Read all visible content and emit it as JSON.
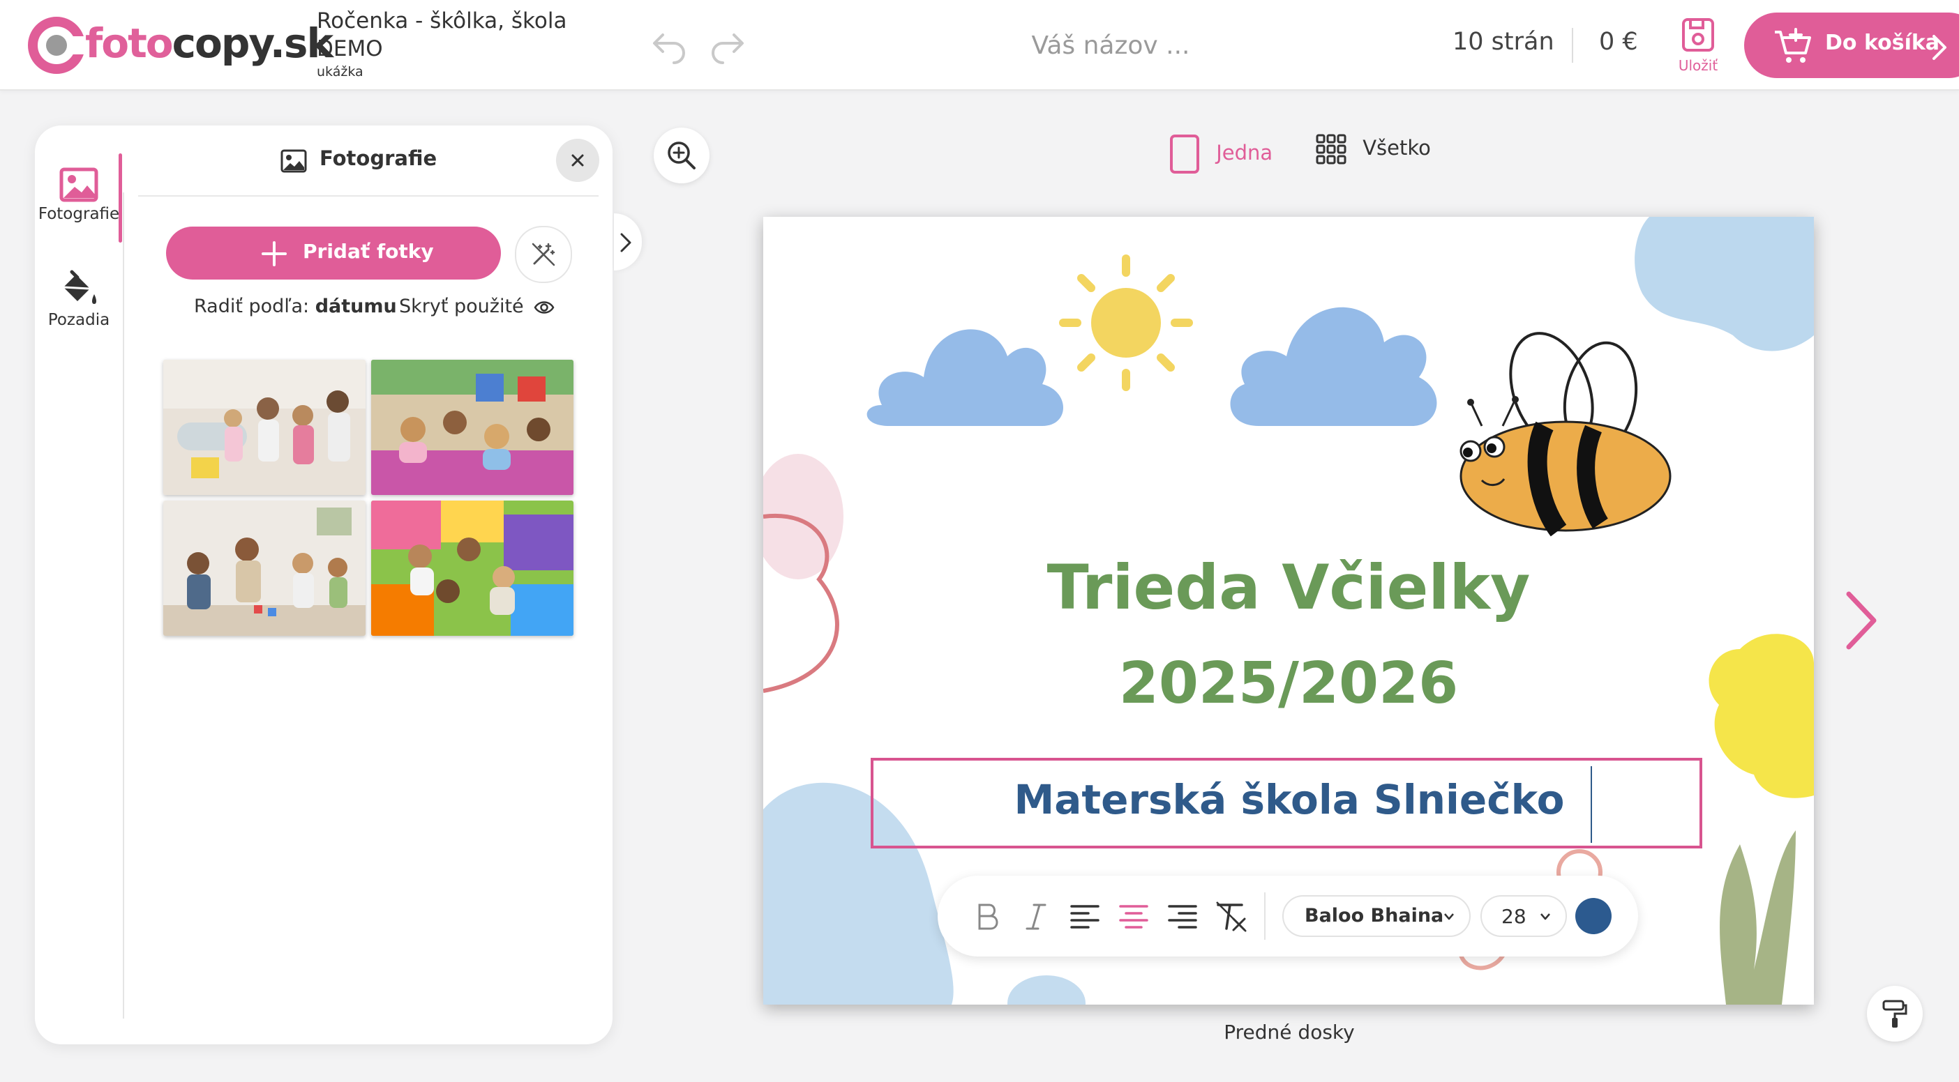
{
  "header": {
    "logo_text_a": "foto",
    "logo_text_b": "copy.sk",
    "project_title": "Ročenka - škôlka, škola DEMO",
    "project_subtitle": "ukážka",
    "title_placeholder": "Váš názov ...",
    "pages": "10 strán",
    "price": "0 €",
    "save_label": "Uložiť",
    "cart_label": "Do košíka"
  },
  "panel": {
    "tabs": [
      {
        "label": "Fotografie",
        "icon": "image-icon"
      },
      {
        "label": "Pozadia",
        "icon": "paint-bucket-icon"
      }
    ],
    "title": "Fotografie",
    "add_photos": "Pridať fotky",
    "sort_prefix": "Radiť podľa:",
    "sort_value": "dátumu",
    "hide_used": "Skryť použité"
  },
  "view": {
    "one_label": "Jedna",
    "all_label": "Všetko"
  },
  "page": {
    "title_line1": "Trieda Včielky",
    "title_line2": "2025/2026",
    "subtitle": "Materská škola Slniečko",
    "page_label": "Predné dosky"
  },
  "toolbar": {
    "font": "Baloo Bhaina",
    "size": "28",
    "color": "#2c5a8f"
  },
  "colors": {
    "brand": "#e05d98",
    "title_green": "#6a9a58",
    "subtitle_blue": "#2f5a8a"
  }
}
